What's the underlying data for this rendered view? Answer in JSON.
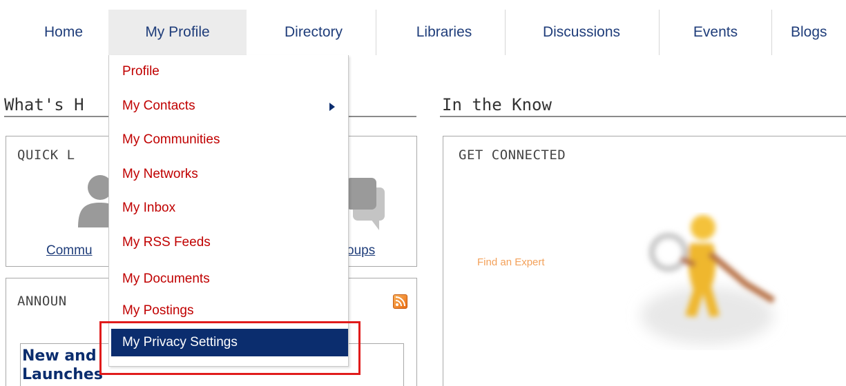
{
  "nav": {
    "tabs": [
      {
        "label": "Home"
      },
      {
        "label": "My Profile"
      },
      {
        "label": "Directory"
      },
      {
        "label": "Libraries"
      },
      {
        "label": "Discussions"
      },
      {
        "label": "Events"
      },
      {
        "label": "Blogs"
      }
    ],
    "active_tab": "My Profile"
  },
  "dropdown": {
    "items": [
      {
        "label": "Profile"
      },
      {
        "label": "My Contacts",
        "has_submenu": true
      },
      {
        "label": "My Communities"
      },
      {
        "label": "My Networks"
      },
      {
        "label": "My Inbox"
      },
      {
        "label": "My RSS Feeds"
      },
      {
        "label": "My Documents"
      },
      {
        "label": "My Postings"
      },
      {
        "label": "My Privacy Settings",
        "selected": true
      }
    ]
  },
  "left": {
    "section_title": "What's H",
    "quick_links": {
      "title": "QUICK L",
      "link_left": "Commu",
      "link_right": "oups"
    },
    "announcements": {
      "title": "ANNOUN",
      "item_line1": "New and",
      "item_line2": "Launches"
    }
  },
  "right": {
    "section_title": "In the Know",
    "get_connected": {
      "title": "GET CONNECTED",
      "find_expert": "Find an Expert"
    }
  },
  "colors": {
    "nav_text": "#1f3d7a",
    "menu_text": "#c00000",
    "menu_selected_bg": "#0b2d6e",
    "highlight_border": "#e01b1b",
    "find_expert": "#f3a15a"
  },
  "icons": [
    "person-icon",
    "chat-bubbles-icon",
    "rss-icon",
    "submenu-arrow-icon"
  ]
}
